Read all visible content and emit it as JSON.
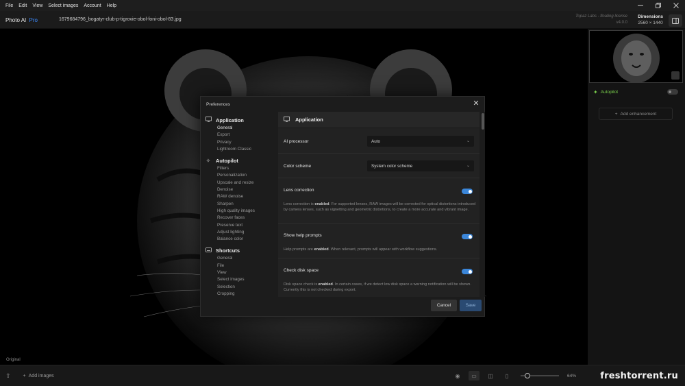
{
  "menubar": {
    "items": [
      "File",
      "Edit",
      "View",
      "Select images",
      "Account",
      "Help"
    ],
    "window_controls": [
      "minimize-icon",
      "restore-icon",
      "close-icon"
    ]
  },
  "titlebar": {
    "app_name": "Photo AI",
    "app_edition": "Pro",
    "filename": "1679684796_bogatyr-club-p-tigrovie-obol-foni-obol-83.jpg",
    "license_text": "Topaz Labs - floating license",
    "version": "v4.0.0",
    "dimensions_label": "Dimensions",
    "dimensions_value": "2560 × 1440"
  },
  "canvas": {
    "label": "Original"
  },
  "right_panel": {
    "autopilot_label": "Autopilot",
    "autopilot_enabled": false,
    "add_enhancement_label": "Add enhancement"
  },
  "bottombar": {
    "add_images_label": "Add images",
    "zoom": "64%",
    "watermark": "freshtorrent.ru"
  },
  "preferences": {
    "title": "Preferences",
    "nav": {
      "application": {
        "label": "Application",
        "items": [
          "General",
          "Export",
          "Privacy",
          "Lightroom Classic"
        ]
      },
      "autopilot": {
        "label": "Autopilot",
        "items": [
          "Filters",
          "Personalization",
          "Upscale and resize",
          "Denoise",
          "RAW denoise",
          "Sharpen",
          "High quality images",
          "Recover faces",
          "Preserve text",
          "Adjust lighting",
          "Balance color"
        ]
      },
      "shortcuts": {
        "label": "Shortcuts",
        "items": [
          "General",
          "File",
          "View",
          "Select images",
          "Selection",
          "Cropping"
        ]
      }
    },
    "content": {
      "header": "Application",
      "ai_processor": {
        "label": "AI processor",
        "value": "Auto"
      },
      "color_scheme": {
        "label": "Color scheme",
        "value": "System color scheme"
      },
      "lens_correction": {
        "label": "Lens correction",
        "enabled": true,
        "desc_pre": "Lens correction is ",
        "desc_bold": "enabled",
        "desc_post": ". For supported lenses, RAW images will be corrected for optical distortions introduced by camera lenses, such as vignetting and geometric distortions, to create a more accurate and vibrant image."
      },
      "help_prompts": {
        "label": "Show help prompts",
        "enabled": true,
        "desc_pre": "Help prompts are ",
        "desc_bold": "enabled",
        "desc_post": ". When relevant, prompts will appear with workflow suggestions."
      },
      "disk_space": {
        "label": "Check disk space",
        "enabled": true,
        "desc_pre": "Disk space check is ",
        "desc_bold": "enabled",
        "desc_post": ". In certain cases, if we detect low disk space a warning notification will be shown. Currently this is not checked during export."
      }
    },
    "buttons": {
      "cancel": "Cancel",
      "save": "Save"
    }
  },
  "colors": {
    "accent_blue": "#3b86d9",
    "autopilot_green": "#7bd14d",
    "pro_blue": "#3d8bff"
  }
}
